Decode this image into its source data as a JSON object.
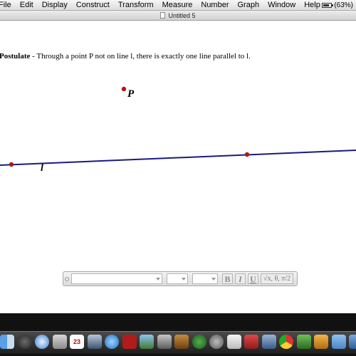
{
  "menubar": {
    "items": [
      "File",
      "Edit",
      "Display",
      "Construct",
      "Transform",
      "Measure",
      "Number",
      "Graph",
      "Window",
      "Help"
    ],
    "battery": "(63%)"
  },
  "window": {
    "title": "Untitled 5"
  },
  "canvas": {
    "postulate_title": "Postulate",
    "postulate_text": " - Through a point P not on line l, there is exactly one line parallel to l.",
    "point_label": "P",
    "line_label": "l",
    "line_color": "#1a1a80",
    "point_color": "#b01818"
  },
  "text_toolbar": {
    "bold": "B",
    "italic": "I",
    "underline": "U",
    "math": "√x, θ, π/2"
  },
  "dock": {
    "icons": [
      "finder-icon",
      "dashboard-icon",
      "safari-icon",
      "mail-icon",
      "calendar-icon",
      "photos-icon",
      "itunes-icon",
      "photo-booth-icon",
      "iphoto-icon",
      "imovie-icon",
      "guitar-icon",
      "time-machine-icon",
      "preferences-icon",
      "textedit-icon",
      "pen-icon",
      "keynote-icon",
      "chrome-icon",
      "sketchpad-icon",
      "pages-icon",
      "folder-icon",
      "stack-icon"
    ],
    "calendar_day": "23"
  }
}
